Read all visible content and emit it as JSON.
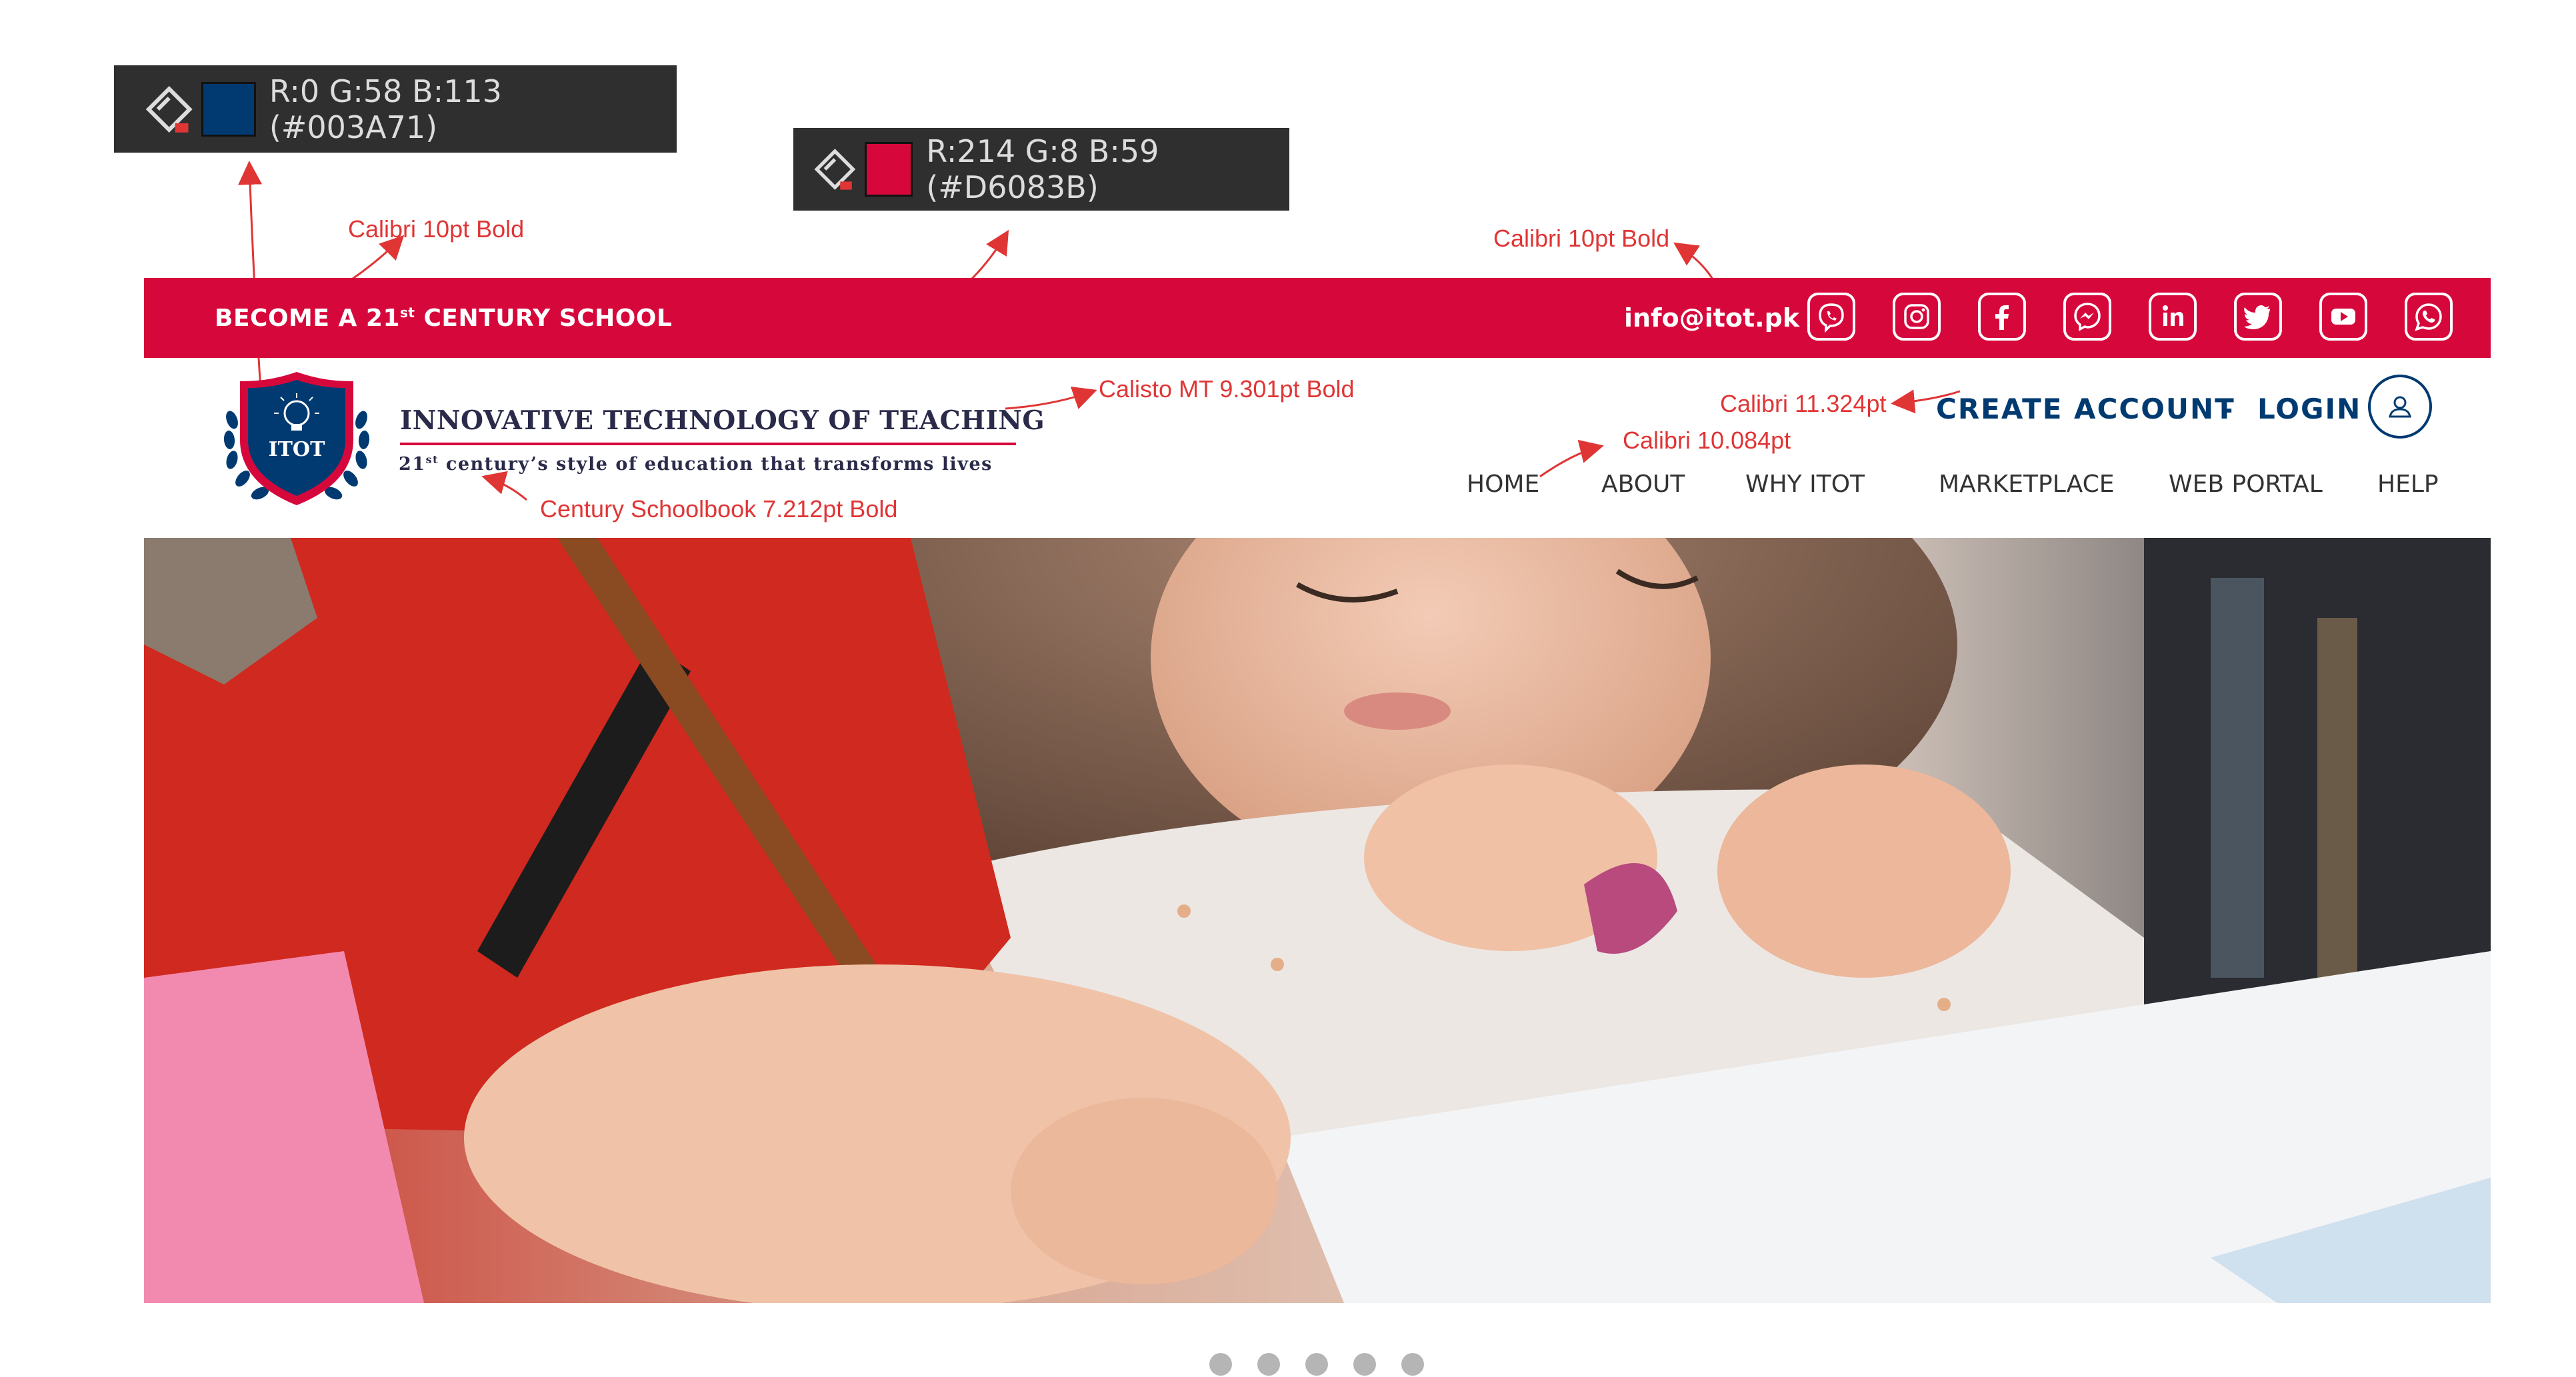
{
  "swatches": [
    {
      "text": "R:0 G:58 B:113 (#003A71)",
      "color": "#003A71"
    },
    {
      "text": "R:214 G:8 B:59 (#D6083B)",
      "color": "#D6083B"
    }
  ],
  "annotations": {
    "top_left_font": "Calibri 10pt Bold",
    "top_right_font": "Calibri 10pt Bold",
    "title_font": "Calisto MT 9.301pt Bold",
    "subtitle_font": "Century Schoolbook 7.212pt Bold",
    "account_font": "Calibri 11.324pt",
    "nav_font": "Calibri 10.084pt"
  },
  "topbar": {
    "tagline_pre": "BECOME A 21",
    "tagline_sup": "st",
    "tagline_post": " CENTURY SCHOOL",
    "email": "info@itot.pk",
    "social_icons": [
      "viber-icon",
      "instagram-icon",
      "facebook-icon",
      "messenger-icon",
      "linkedin-icon",
      "twitter-icon",
      "youtube-icon",
      "whatsapp-icon"
    ]
  },
  "logo": {
    "badge_text": "ITOT"
  },
  "brand": {
    "title": "INNOVATIVE TECHNOLOGY OF TEACHING",
    "subtitle_pre": "21",
    "subtitle_sup": "st",
    "subtitle_post": " century’s style of education that transforms lives"
  },
  "account": {
    "create": "CREATE ACCOUNT",
    "separator": "-",
    "login": "LOGIN"
  },
  "nav": [
    "HOME",
    "ABOUT",
    "WHY ITOT",
    "MARKETPLACE",
    "WEB PORTAL",
    "HELP"
  ],
  "carousel": {
    "slides": 5,
    "active": 0
  },
  "colors": {
    "brand_blue": "#003A71",
    "brand_red": "#D6083B",
    "annotation_red": "#E03535"
  }
}
